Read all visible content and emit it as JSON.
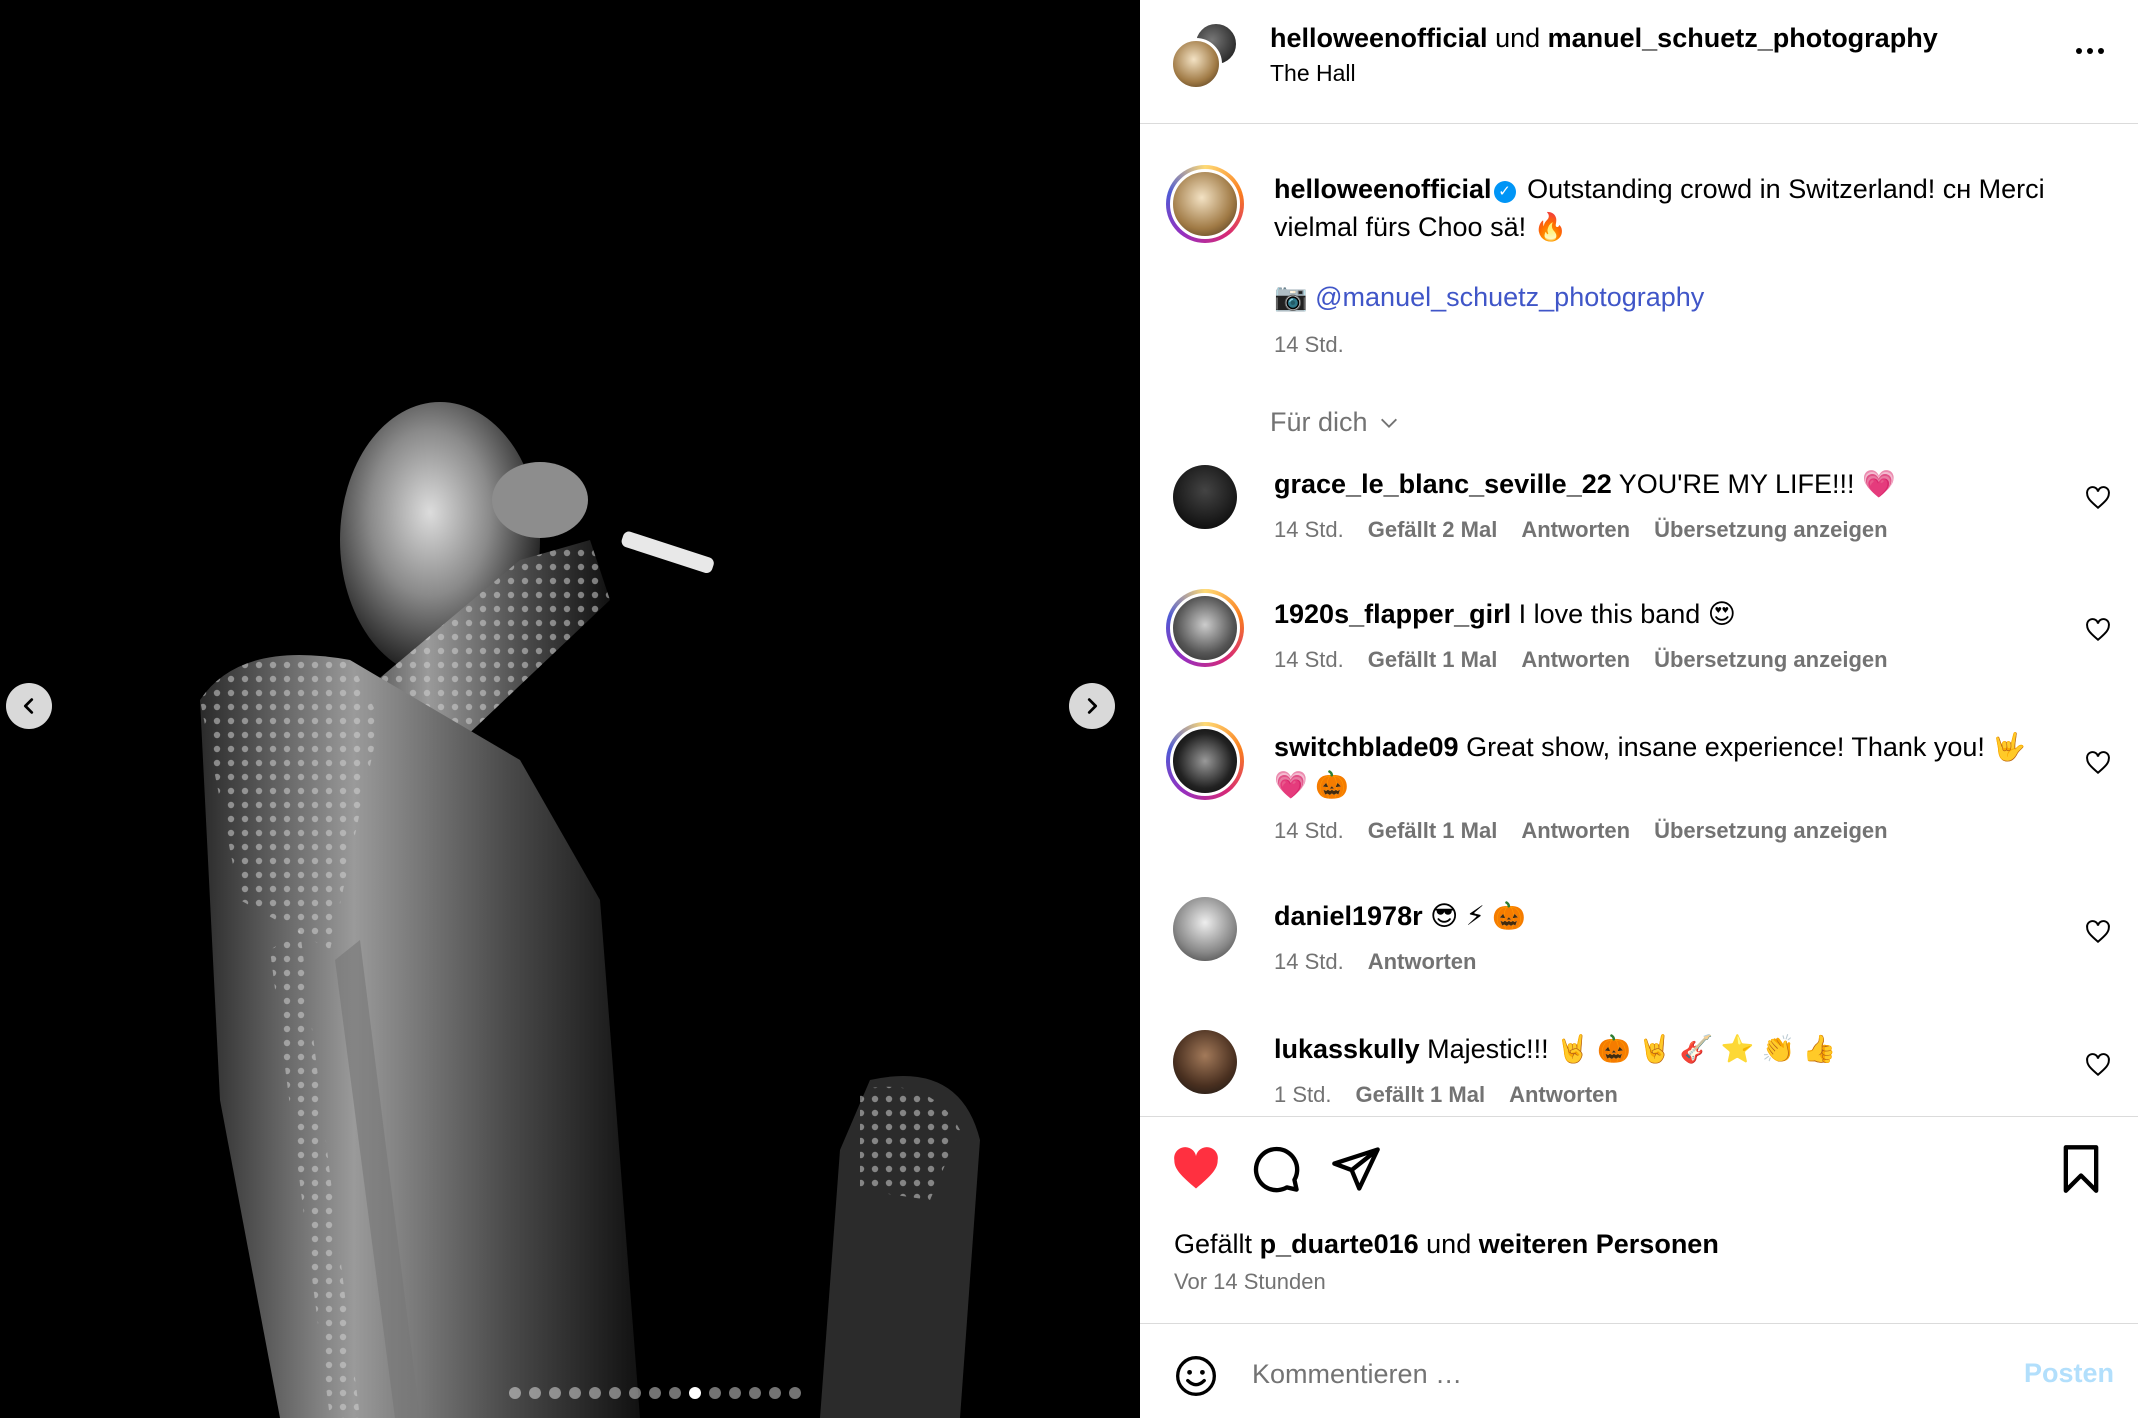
{
  "carousel": {
    "total_slides": 15,
    "active_slide": 10
  },
  "header": {
    "user1": "helloweenofficial",
    "connector": "und",
    "user2": "manuel_schuetz_photography",
    "location": "The Hall",
    "more_icon": "more-horizontal-icon"
  },
  "caption": {
    "username": "helloweenofficial",
    "verified_icon": "verified-badge-icon",
    "text": "Outstanding crowd in Switzerland! ᴄʜ Merci vielmal fürs Choo sä! 🔥",
    "credit_icon": "📷",
    "credit_link": "@manuel_schuetz_photography",
    "time": "14 Std."
  },
  "sort": {
    "label": "Für dich"
  },
  "comments": [
    {
      "username": "grace_le_blanc_seville_22",
      "text": "YOU'RE MY LIFE!!! 💗",
      "time": "14 Std.",
      "likes": "Gefällt 2 Mal",
      "reply": "Antworten",
      "translate": "Übersetzung anzeigen"
    },
    {
      "username": "1920s_flapper_girl",
      "text": "I love this band 😍",
      "time": "14 Std.",
      "likes": "Gefällt 1 Mal",
      "reply": "Antworten",
      "translate": "Übersetzung anzeigen"
    },
    {
      "username": "switchblade09",
      "text": "Great show, insane experience! Thank you! 🤟 💗 🎃",
      "time": "14 Std.",
      "likes": "Gefällt 1 Mal",
      "reply": "Antworten",
      "translate": "Übersetzung anzeigen"
    },
    {
      "username": "daniel1978r",
      "text": "😎 ⚡ 🎃",
      "time": "14 Std.",
      "reply": "Antworten"
    },
    {
      "username": "lukasskully",
      "text": "Majestic!!! 🤘 🎃 🤘 🎸 ⭐ 👏 👍",
      "time": "1 Std.",
      "likes": "Gefällt 1 Mal",
      "reply": "Antworten"
    }
  ],
  "actions": {
    "like_icon": "heart-filled-icon",
    "comment_icon": "comment-icon",
    "share_icon": "share-icon",
    "save_icon": "bookmark-icon",
    "like_color": "#ff3040"
  },
  "likes_line": {
    "prefix": "Gefällt",
    "user": "p_duarte016",
    "connector": "und",
    "others": "weiteren Personen"
  },
  "post_time": "Vor 14 Stunden",
  "composer": {
    "placeholder": "Kommentieren …",
    "post_label": "Posten",
    "emoji_icon": "smiley-icon"
  }
}
